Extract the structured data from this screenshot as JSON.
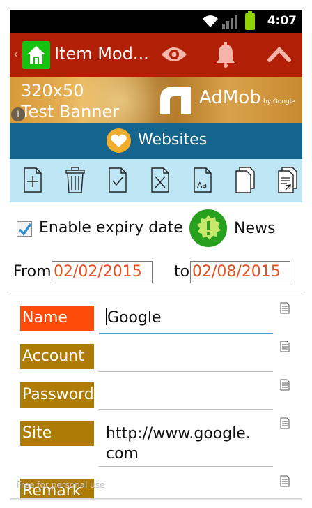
{
  "status_bar": {
    "time": "4:07",
    "icons": [
      "wifi-icon",
      "signal-icon",
      "battery-icon"
    ],
    "battery_color": "#8fd400"
  },
  "action_bar": {
    "back_glyph": "‹",
    "title": "Item Mod...",
    "background": "#b01f06",
    "actions": [
      "eye-icon",
      "bell-icon",
      "chevron-up-icon"
    ]
  },
  "ad_banner": {
    "line1": "320x50",
    "line2": "Test Banner",
    "brand": "AdMob",
    "by": "by Google",
    "info": "i"
  },
  "category": {
    "icon": "heart-icon",
    "label": "Websites",
    "background": "#14658d"
  },
  "toolbar": {
    "background": "#bfe6f5",
    "tools": [
      "add-item-icon",
      "delete-icon",
      "check-icon",
      "uncheck-icon",
      "font-icon",
      "copy-icon",
      "export-icon"
    ]
  },
  "expiry": {
    "label": "Enable expiry date",
    "checked": true
  },
  "news": {
    "label": "News",
    "icon_color": "#27a01e"
  },
  "date_range": {
    "from_label": "From",
    "from_value": "02/02/2015",
    "to_label": "to",
    "to_value": "02/08/2015",
    "value_color": "#e4511e"
  },
  "fields": [
    {
      "label": "Name",
      "value": "Google",
      "color": "#fd4c0a",
      "active": true
    },
    {
      "label": "Account",
      "value": "",
      "color": "#ad7c06",
      "active": false
    },
    {
      "label": "Password",
      "value": "",
      "color": "#ad7c06",
      "active": false
    },
    {
      "label": "Site",
      "value_line1": "http://www.google.",
      "value_line2": "com",
      "color": "#ad7c06",
      "active": false
    },
    {
      "label": "Remark",
      "value": "",
      "color": "#ad7c06",
      "active": false
    }
  ],
  "watermark": "Free for personal use"
}
